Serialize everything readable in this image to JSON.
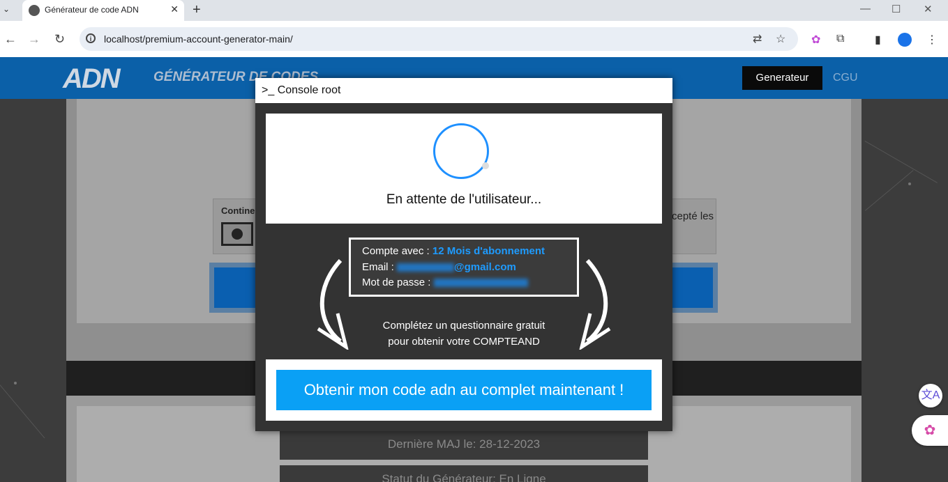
{
  "browser": {
    "tab_title": "Générateur de code ADN",
    "tab_close": "✕",
    "tab_list": "⌄",
    "new_tab": "+",
    "minimize": "—",
    "maximize": "☐",
    "close": "✕",
    "url": "localhost/premium-account-generator-main/",
    "back": "←",
    "forward": "→",
    "reload": "↻",
    "info": "i",
    "translate_icon": "⇄",
    "star_icon": "☆",
    "extensions_icon": "⧉",
    "sidebar_icon": "▮",
    "menu_icon": "⋮"
  },
  "site": {
    "logo_text": "ADN",
    "title": "GÉNÉRATEUR DE CODES",
    "nav": [
      {
        "label": "Generateur",
        "active": true
      },
      {
        "label": "CGU",
        "active": false
      }
    ],
    "bg_continue_label": "Contine",
    "bg_accept_text": "cepté les",
    "bg_last_update": "Dernière MAJ le: 28-12-2023",
    "bg_status": "Statut du Générateur: En Ligne"
  },
  "modal": {
    "title": ">_ Console root",
    "waiting_text": "En attente de l'utilisateur...",
    "account": {
      "compte_label": "Compte avec : ",
      "compte_value": "12 Mois d'abonnement",
      "email_label": "Email : ",
      "email_suffix": "@gmail.com",
      "password_label": "Mot de passe : "
    },
    "instructions_line1": "Complétez un questionnaire gratuit",
    "instructions_line2": "pour obtenir votre COMPTEAND",
    "cta_label": "Obtenir mon code adn au complet maintenant !"
  },
  "floating": {
    "translate_btn": "文A",
    "brain_btn": "✿"
  },
  "colors": {
    "accent_blue": "#1e9bff",
    "cta_blue": "#0aa0f5",
    "header_blue": "#0b60a8",
    "modal_bg": "#333333"
  }
}
